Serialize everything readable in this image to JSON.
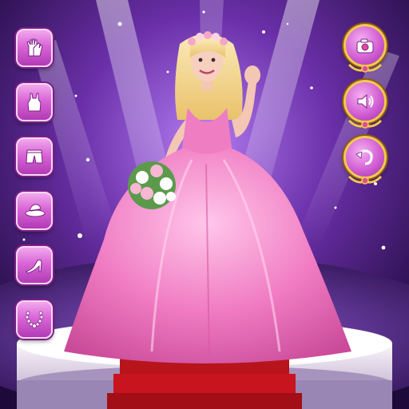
{
  "colors": {
    "bg_top": "#2a0f4a",
    "spotlight": "#c9a6ff",
    "stage_purple": "#5a2a8a",
    "carpet_red": "#c8141e",
    "dress_pink": "#f27fc4",
    "dress_light": "#ffc2e8",
    "hair_blonde": "#f6dd9a",
    "button_pink": "#d965d6",
    "button_gold": "#f2c94c"
  },
  "left_toolbar": [
    {
      "id": "gloves",
      "icon": "gloves-icon"
    },
    {
      "id": "tops",
      "icon": "tank-top-icon"
    },
    {
      "id": "bottoms",
      "icon": "shorts-icon"
    },
    {
      "id": "hats",
      "icon": "hat-icon"
    },
    {
      "id": "shoes",
      "icon": "high-heel-icon"
    },
    {
      "id": "necklaces",
      "icon": "necklace-icon"
    }
  ],
  "right_toolbar": [
    {
      "id": "screenshot",
      "icon": "camera-icon"
    },
    {
      "id": "sound",
      "icon": "speaker-icon"
    },
    {
      "id": "reset",
      "icon": "undo-icon"
    }
  ]
}
